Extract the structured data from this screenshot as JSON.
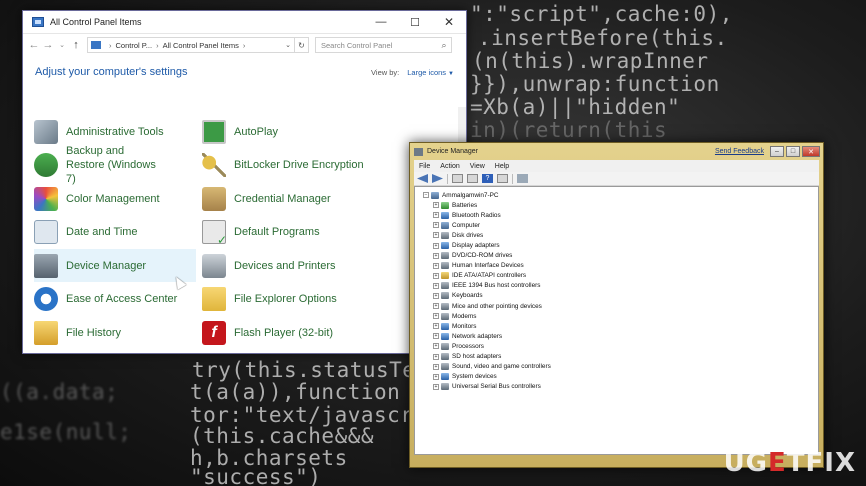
{
  "background": {
    "code_lines": [
      "\":\"script\",cache:0),",
      ".insertBefore(this.",
      "(n(this).wrapInner",
      "}}),unwrap:function",
      "=Xb(a)||\"hidden\"",
      "in)(return(this",
      "try(this.statusText",
      "t(a(a)),function",
      "tor:\"text/javascrip",
      "(this.cache&&&",
      "h,b.charsets",
      "\"success\")"
    ]
  },
  "control_panel": {
    "title": "All Control Panel Items",
    "address": {
      "crumb1": "Control P...",
      "crumb2": "All Control Panel Items"
    },
    "search_placeholder": "Search Control Panel",
    "heading": "Adjust your computer's settings",
    "view_by_label": "View by:",
    "view_by_value": "Large icons",
    "items": [
      {
        "label": "Administrative Tools",
        "icon": "tools-icon"
      },
      {
        "label": "AutoPlay",
        "icon": "autoplay-icon"
      },
      {
        "label": "Backup and Restore (Windows 7)",
        "icon": "backup-icon"
      },
      {
        "label": "BitLocker Drive Encryption",
        "icon": "bitlocker-key-icon"
      },
      {
        "label": "Color Management",
        "icon": "color-management-icon"
      },
      {
        "label": "Credential Manager",
        "icon": "credential-manager-icon"
      },
      {
        "label": "Date and Time",
        "icon": "date-time-icon"
      },
      {
        "label": "Default Programs",
        "icon": "default-programs-icon"
      },
      {
        "label": "Device Manager",
        "icon": "device-manager-icon"
      },
      {
        "label": "Devices and Printers",
        "icon": "printer-icon"
      },
      {
        "label": "Ease of Access Center",
        "icon": "ease-of-access-icon"
      },
      {
        "label": "File Explorer Options",
        "icon": "folder-options-icon"
      },
      {
        "label": "File History",
        "icon": "file-history-icon"
      },
      {
        "label": "Flash Player (32-bit)",
        "icon": "flash-icon"
      }
    ]
  },
  "device_manager": {
    "title": "Device Manager",
    "feedback": "Send Feedback",
    "menu": [
      "File",
      "Action",
      "View",
      "Help"
    ],
    "root": "Ammalgamwin7-PC",
    "nodes": [
      "Batteries",
      "Bluetooth Radios",
      "Computer",
      "Disk drives",
      "Display adapters",
      "DVD/CD-ROM drives",
      "Human Interface Devices",
      "IDE ATA/ATAPI controllers",
      "IEEE 1394 Bus host controllers",
      "Keyboards",
      "Mice and other pointing devices",
      "Modems",
      "Monitors",
      "Network adapters",
      "Processors",
      "SD host adapters",
      "Sound, video and game controllers",
      "System devices",
      "Universal Serial Bus controllers"
    ]
  },
  "watermark": {
    "left": "UG",
    "mid": "E",
    "right": "TFIX"
  }
}
